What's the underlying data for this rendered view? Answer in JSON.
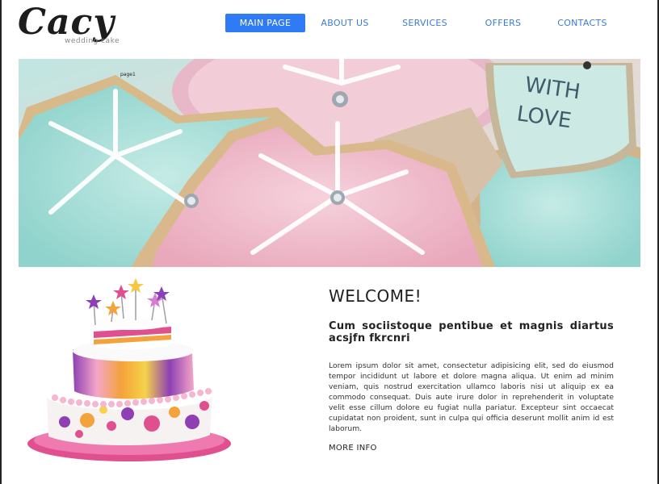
{
  "brand": {
    "name": "Cacy",
    "tagline": "wedding cake"
  },
  "nav": {
    "items": [
      {
        "label": "MAIN PAGE",
        "active": true
      },
      {
        "label": "ABOUT US",
        "active": false
      },
      {
        "label": "SERVICES",
        "active": false
      },
      {
        "label": "OFFERS",
        "active": false
      },
      {
        "label": "CONTACTS",
        "active": false
      }
    ],
    "active_color": "#2f7bf5",
    "link_color": "#3a7bd5"
  },
  "hero": {
    "caption": "page1",
    "image_description": "decorated star-shaped sugar cookies with snowflake icing; heart cookie reads WITH LOVE",
    "heart_text": [
      "WITH",
      "LOVE"
    ]
  },
  "welcome": {
    "title": "WELCOME!",
    "subtitle": "Cum sociistoque pentibue et magnis diartus acsjfn fkrcnri",
    "body": "Lorem ipsum dolor sit amet, consectetur adipisicing elit, sed do eiusmod tempor incididunt ut labore et dolore magna aliqua. Ut enim ad minim veniam, quis nostrud exercitation ullamco laboris nisi ut aliquip ex ea commodo consequat. Duis aute irure dolor in reprehenderit in voluptate velit esse cillum dolore eu fugiat nulla pariatur. Excepteur sint occaecat cupidatat non proident, sunt in culpa qui officia deserunt mollit anim id est laborum.",
    "more_label": "MORE INFO"
  }
}
